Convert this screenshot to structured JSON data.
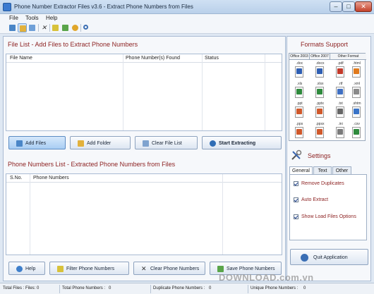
{
  "window": {
    "title": "Phone Number Extractor Files v3.6 - Extract Phone Numbers from Files",
    "controls": {
      "minimize": "–",
      "maximize": "□",
      "close": "✕"
    }
  },
  "menu": {
    "file": "File",
    "tools": "Tools",
    "help": "Help"
  },
  "toolbar": {
    "icons": [
      "add-files-icon",
      "add-folder-icon",
      "copy-icon",
      "clear-icon",
      "filter-icon",
      "save-icon",
      "key-icon",
      "search-icon"
    ]
  },
  "file_list": {
    "title": "File List - Add Files to Extract Phone Numbers",
    "columns": [
      "File Name",
      "Phone Number(s) Found",
      "Status"
    ],
    "rows": []
  },
  "file_buttons": {
    "add_files": "Add Files",
    "add_folder": "Add Folder",
    "clear_file_list": "Clear File List",
    "start_extracting": "Start Extracting"
  },
  "phone_list": {
    "title": "Phone Numbers List - Extracted Phone Numbers from Files",
    "columns": [
      "S.No.",
      "Phone Numbers"
    ],
    "rows": []
  },
  "bottom_buttons": {
    "help": "Help",
    "filter": "Filter Phone Numbers",
    "clear": "Clear Phone Numbers",
    "save": "Save Phone Numbers"
  },
  "formats": {
    "title": "Formats Support",
    "headers": [
      "Office 2003",
      "Office 2007",
      "Other Format"
    ],
    "extensions": [
      ".doc",
      ".docx",
      ".pdf",
      ".html",
      ".xls",
      ".xlsx",
      ".rtf",
      ".xml",
      ".ppt",
      ".pptx",
      ".txt",
      ".shtm",
      ".pps",
      ".ppsx",
      ".ini",
      ".csv"
    ]
  },
  "settings": {
    "title": "Settings",
    "tabs": [
      "General",
      "Text",
      "Other"
    ],
    "options": [
      "Remove Duplicates",
      "Auto Extract",
      "Show Load Files Options"
    ]
  },
  "quit_button": "Quit Application",
  "status": {
    "total_files": "Total Files : Files: 0",
    "total_phone": "Total Phone Numbers :",
    "total_phone_value": "0",
    "duplicate": "Duplicate Phone Numbers :",
    "duplicate_value": "0",
    "unique": "Unique Phone Numbers :",
    "unique_value": "0"
  },
  "watermark": "DOWNLOAD.com.vn",
  "colors": {
    "section_title": "#8b1f1f",
    "window_bg": "#dfe8f3",
    "accent": "#3b7ad0"
  }
}
